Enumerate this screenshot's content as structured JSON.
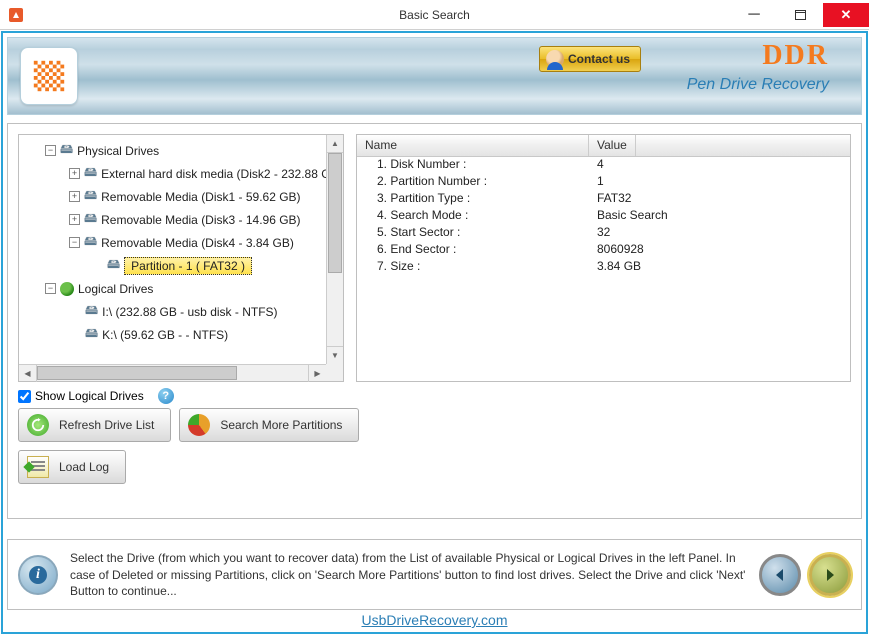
{
  "window": {
    "title": "Basic Search"
  },
  "banner": {
    "contact": "Contact us",
    "brand": "DDR",
    "brand_sub": "Pen Drive Recovery"
  },
  "tree": {
    "physical_label": "Physical Drives",
    "logical_label": "Logical Drives",
    "physical": [
      "External hard disk media (Disk2 - 232.88 G",
      "Removable Media (Disk1 - 59.62 GB)",
      "Removable Media (Disk3 - 14.96 GB)",
      "Removable Media (Disk4 - 3.84 GB)"
    ],
    "selected_partition": "Partition - 1 ( FAT32 )",
    "logical": [
      "I:\\ (232.88 GB - usb disk - NTFS)",
      "K:\\ (59.62 GB -  - NTFS)"
    ]
  },
  "details": {
    "header_name": "Name",
    "header_value": "Value",
    "rows": [
      {
        "name": "1. Disk Number :",
        "value": "4"
      },
      {
        "name": "2. Partition Number :",
        "value": "1"
      },
      {
        "name": "3. Partition Type :",
        "value": "FAT32"
      },
      {
        "name": "4. Search Mode :",
        "value": "Basic Search"
      },
      {
        "name": "5. Start Sector :",
        "value": "32"
      },
      {
        "name": "6. End Sector :",
        "value": "8060928"
      },
      {
        "name": "7. Size :",
        "value": "3.84 GB"
      }
    ]
  },
  "options": {
    "show_logical": "Show Logical Drives"
  },
  "buttons": {
    "refresh": "Refresh Drive List",
    "search_more": "Search More Partitions",
    "load_log": "Load Log"
  },
  "instruction": "Select the Drive (from which you want to recover data) from the List of available Physical or Logical Drives in the left Panel. In case of Deleted or missing Partitions, click on 'Search More Partitions' button to find lost drives. Select the Drive and click 'Next' Button to continue...",
  "footer": "UsbDriveRecovery.com"
}
